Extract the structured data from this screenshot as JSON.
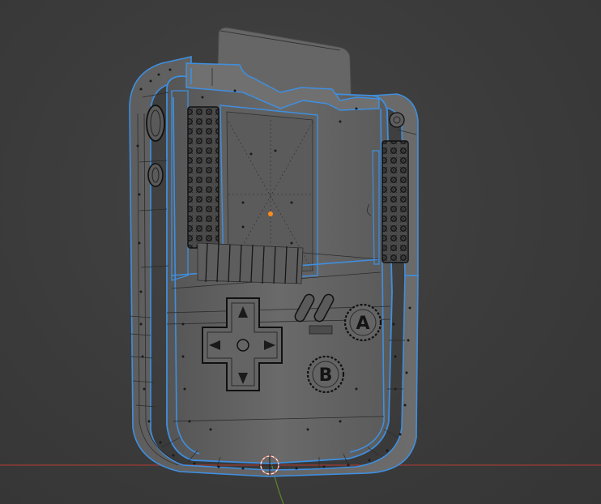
{
  "viewport": {
    "background": "#3a3a3a",
    "selection_outline_color": "#3f8fe0",
    "x_axis_color": "#9c3b33",
    "y_axis_color": "#5f8a2a",
    "origin_marker_color": "#e08070",
    "pivot_point_color": "#ff8c1a"
  },
  "model": {
    "button_a_label": "A",
    "button_b_label": "B",
    "display": "wireframe-with-selection-outline"
  }
}
